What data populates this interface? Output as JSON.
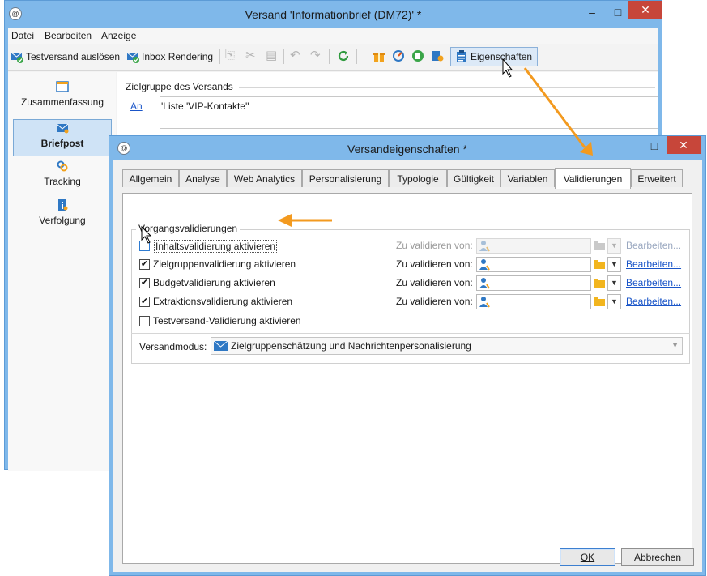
{
  "back_window": {
    "title": "Versand 'Informationbrief (DM72)' *",
    "menu": [
      "Datei",
      "Bearbeiten",
      "Anzeige"
    ],
    "toolbar": {
      "test_send": "Testversand auslösen",
      "inbox_rendering": "Inbox Rendering",
      "properties": "Eigenschaften"
    },
    "sidebar": [
      {
        "label": "Zusammenfassung",
        "icon": "summary-icon"
      },
      {
        "label": "Briefpost",
        "icon": "letter-icon",
        "selected": true
      },
      {
        "label": "Tracking",
        "icon": "tracking-icon"
      },
      {
        "label": "Verfolgung",
        "icon": "info-icon"
      }
    ],
    "target_group": {
      "legend": "Zielgruppe des Versands",
      "link": "An",
      "value": "'Liste 'VIP-Kontakte''"
    }
  },
  "dialog": {
    "title": "Versandeigenschaften *",
    "tabs": [
      "Allgemein",
      "Analyse",
      "Web Analytics",
      "Personalisierung",
      "Typologie",
      "Gültigkeit",
      "Variablen",
      "Validierungen",
      "Erweitert"
    ],
    "active_tab": "Validierungen",
    "group_title": "Vorgangsvalidierungen",
    "validations": [
      {
        "label": "Inhaltsvalidierung aktivieren",
        "checked": false,
        "enabled_row": false,
        "validate_label": "Zu validieren von:",
        "edit": "Bearbeiten..."
      },
      {
        "label": "Zielgruppenvalidierung aktivieren",
        "checked": true,
        "enabled_row": true,
        "validate_label": "Zu validieren von:",
        "edit": "Bearbeiten..."
      },
      {
        "label": "Budgetvalidierung aktivieren",
        "checked": true,
        "enabled_row": true,
        "validate_label": "Zu validieren von:",
        "edit": "Bearbeiten..."
      },
      {
        "label": "Extraktionsvalidierung aktivieren",
        "checked": true,
        "enabled_row": true,
        "validate_label": "Zu validieren von:",
        "edit": "Bearbeiten..."
      }
    ],
    "test_validation": {
      "label": "Testversand-Validierung aktivieren",
      "checked": false
    },
    "mode_label": "Versandmodus:",
    "mode_value": "Zielgruppenschätzung und Nachrichtenpersonalisierung",
    "ok": "OK",
    "cancel": "Abbrechen"
  },
  "colors": {
    "title_bar": "#7fb8ea",
    "close_button": "#c7463a",
    "accent_arrow": "#f39a1f",
    "link": "#1a55c8"
  }
}
